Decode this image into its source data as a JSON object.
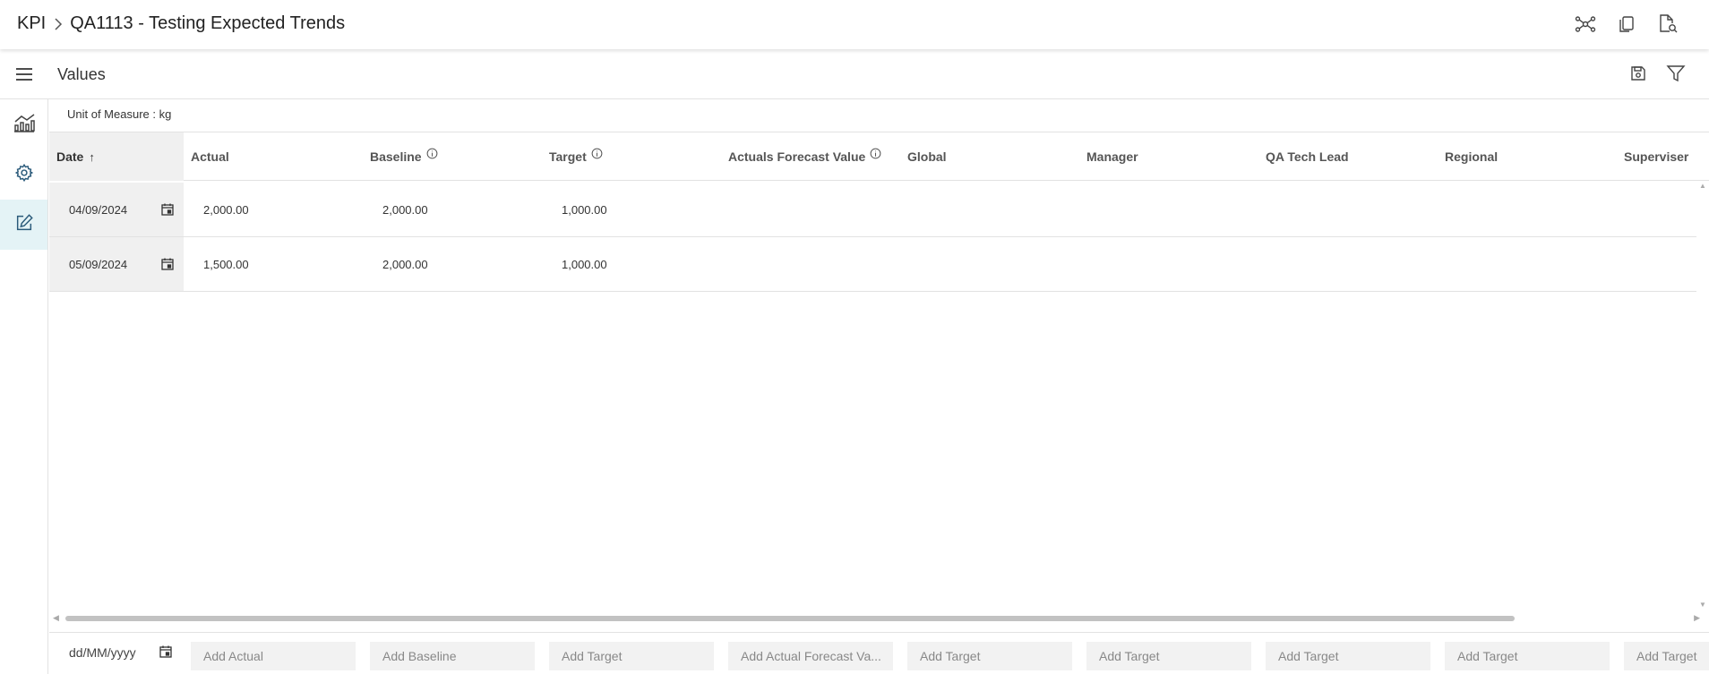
{
  "breadcrumb": {
    "root": "KPI",
    "current": "QA1113 - Testing Expected Trends"
  },
  "top_icons": [
    "hierarchy-icon",
    "copy-icon",
    "document-search-icon"
  ],
  "subheader": {
    "title": "Values",
    "icons": [
      "save-icon",
      "filter-icon"
    ]
  },
  "sidebar": {
    "items": [
      {
        "icon": "chart-icon",
        "active": false
      },
      {
        "icon": "gear-icon",
        "active": false
      },
      {
        "icon": "edit-icon",
        "active": true
      }
    ]
  },
  "unit_of_measure": "Unit of Measure : kg",
  "table": {
    "sort_indicator": "↑",
    "columns": [
      {
        "label": "Date"
      },
      {
        "label": "Actual"
      },
      {
        "label": "Baseline"
      },
      {
        "label": "Target"
      },
      {
        "label": "Actuals Forecast Value"
      },
      {
        "label": "Global"
      },
      {
        "label": "Manager"
      },
      {
        "label": "QA Tech Lead"
      },
      {
        "label": "Regional"
      },
      {
        "label": "Superviser"
      }
    ],
    "rows": [
      {
        "date": "04/09/2024",
        "actual": "2,000.00",
        "baseline": "2,000.00",
        "target": "1,000.00"
      },
      {
        "date": "05/09/2024",
        "actual": "1,500.00",
        "baseline": "2,000.00",
        "target": "1,000.00"
      }
    ]
  },
  "add_row": {
    "date_placeholder": "dd/MM/yyyy",
    "placeholders": [
      "Add Actual",
      "Add Baseline",
      "Add Target",
      "Add Actual Forecast Va...",
      "Add Target",
      "Add Target",
      "Add Target",
      "Add Target",
      "Add Target"
    ]
  },
  "colors": {
    "active_nav_bg": "#e4f3f6",
    "date_column_bg": "#f0f0f0",
    "icon": "#444444"
  }
}
